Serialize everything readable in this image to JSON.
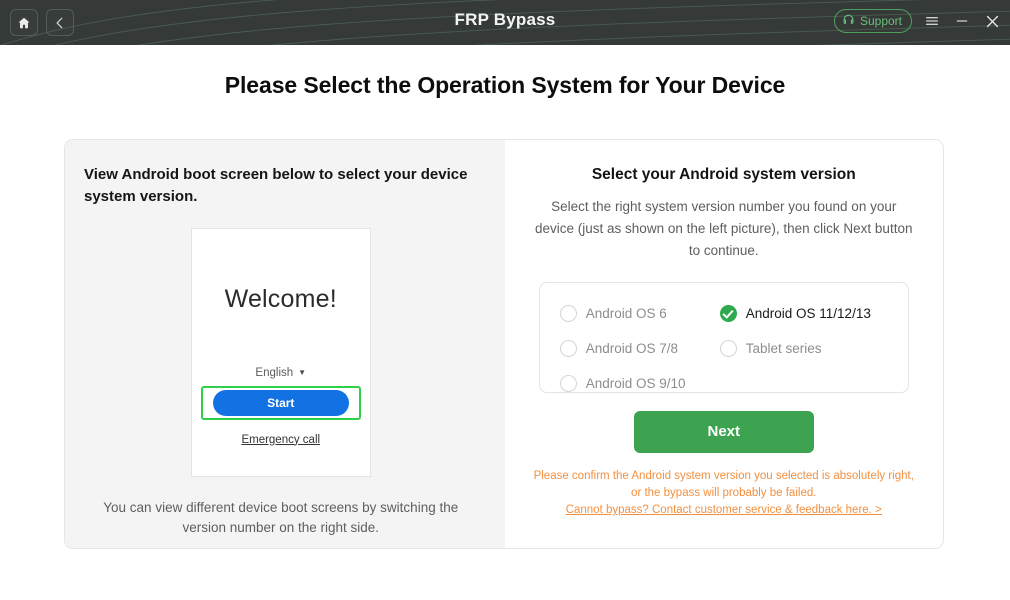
{
  "titlebar": {
    "title": "FRP Bypass",
    "home_icon": "home-icon",
    "back_icon": "back-chevron-icon",
    "support_label": "Support",
    "support_icon": "headset-icon",
    "menu_icon": "hamburger-menu-icon",
    "minimize_icon": "minimize-icon",
    "close_icon": "close-icon",
    "bg_color": "#353a39",
    "accent_green": "#6bbd78"
  },
  "page": {
    "heading": "Please Select the Operation System for Your Device"
  },
  "left_pane": {
    "title": "View Android boot screen below to select your device system version.",
    "phone": {
      "welcome": "Welcome!",
      "language": "English",
      "language_caret": "▼",
      "start_label": "Start",
      "emergency_label": "Emergency call",
      "start_button_color": "#1272e3",
      "highlight_color": "#2fd04a"
    },
    "caption": "You can view different device boot screens by switching the version number on the right side."
  },
  "right_pane": {
    "title": "Select your Android system version",
    "description": "Select the right system version number you found on your device (just as shown on the left picture), then click Next button to continue.",
    "options": [
      {
        "label": "Android OS 6",
        "selected": false,
        "column": "a"
      },
      {
        "label": "Android OS 11/12/13",
        "selected": true,
        "column": "b"
      },
      {
        "label": "Android OS 7/8",
        "selected": false,
        "column": "a"
      },
      {
        "label": "Tablet series",
        "selected": false,
        "column": "b"
      },
      {
        "label": "Android OS 9/10",
        "selected": false,
        "column": "a"
      }
    ],
    "next_label": "Next",
    "next_color": "#3da351",
    "warning": "Please confirm the Android system version you selected is absolutely right, or the bypass will probably be failed.",
    "warning_link": "Cannot bypass? Contact customer service & feedback here. >",
    "warning_color": "#f29040"
  }
}
